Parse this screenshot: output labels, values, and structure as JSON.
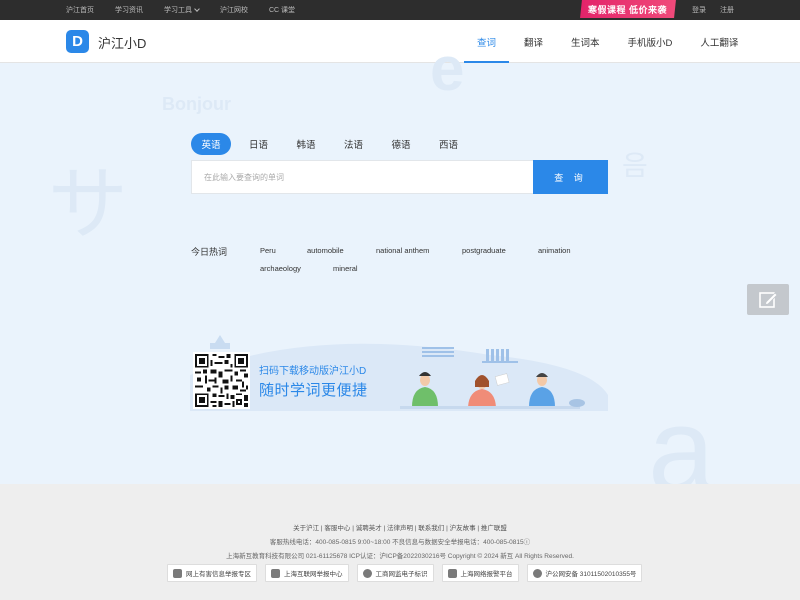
{
  "topbar": {
    "links": [
      "沪江首页",
      "学习资讯",
      "学习工具",
      "沪江网校",
      "CC 课堂"
    ],
    "promo": "寒假课程 低价来袭",
    "login": "登录",
    "register": "注册"
  },
  "header": {
    "logo_letter": "D",
    "brand": "沪江小D",
    "nav": [
      "查词",
      "翻译",
      "生词本",
      "手机版小D",
      "人工翻译"
    ]
  },
  "decor": {
    "bonjour": "Bonjour",
    "e": "e",
    "sa": "サ",
    "eum": "음",
    "a": "a"
  },
  "langs": [
    "英语",
    "日语",
    "韩语",
    "法语",
    "德语",
    "西语"
  ],
  "search": {
    "placeholder": "在此输入要查询的单词",
    "button": "查 询"
  },
  "hot": {
    "label": "今日热词",
    "words": [
      "Peru",
      "automobile",
      "national anthem",
      "postgraduate",
      "animation",
      "archaeology",
      "mineral"
    ]
  },
  "banner": {
    "line1": "扫码下载移动版沪江小D",
    "line2": "随时学词更便捷"
  },
  "footer": {
    "links": "关于沪江 | 客服中心 | 诚聘英才 | 法律声明 | 联系我们 | 沪友故事 | 推广联盟",
    "hotline": "客服热线电话：400-085-0815 9:00~18:00    不良信息与数据安全举报电话：400-085-0815ⓘ",
    "company": "上海新互教育科技有限公司 021-61125678    ICP认证：沪ICP备2022030216号    Copyright © 2024 新互 All Rights Reserved.",
    "badges": [
      "网上有害信息举报专区",
      "上海互联网举报中心",
      "工商网监电子标识",
      "上海网络报警平台",
      "沪公网安备 31011502010355号"
    ]
  }
}
